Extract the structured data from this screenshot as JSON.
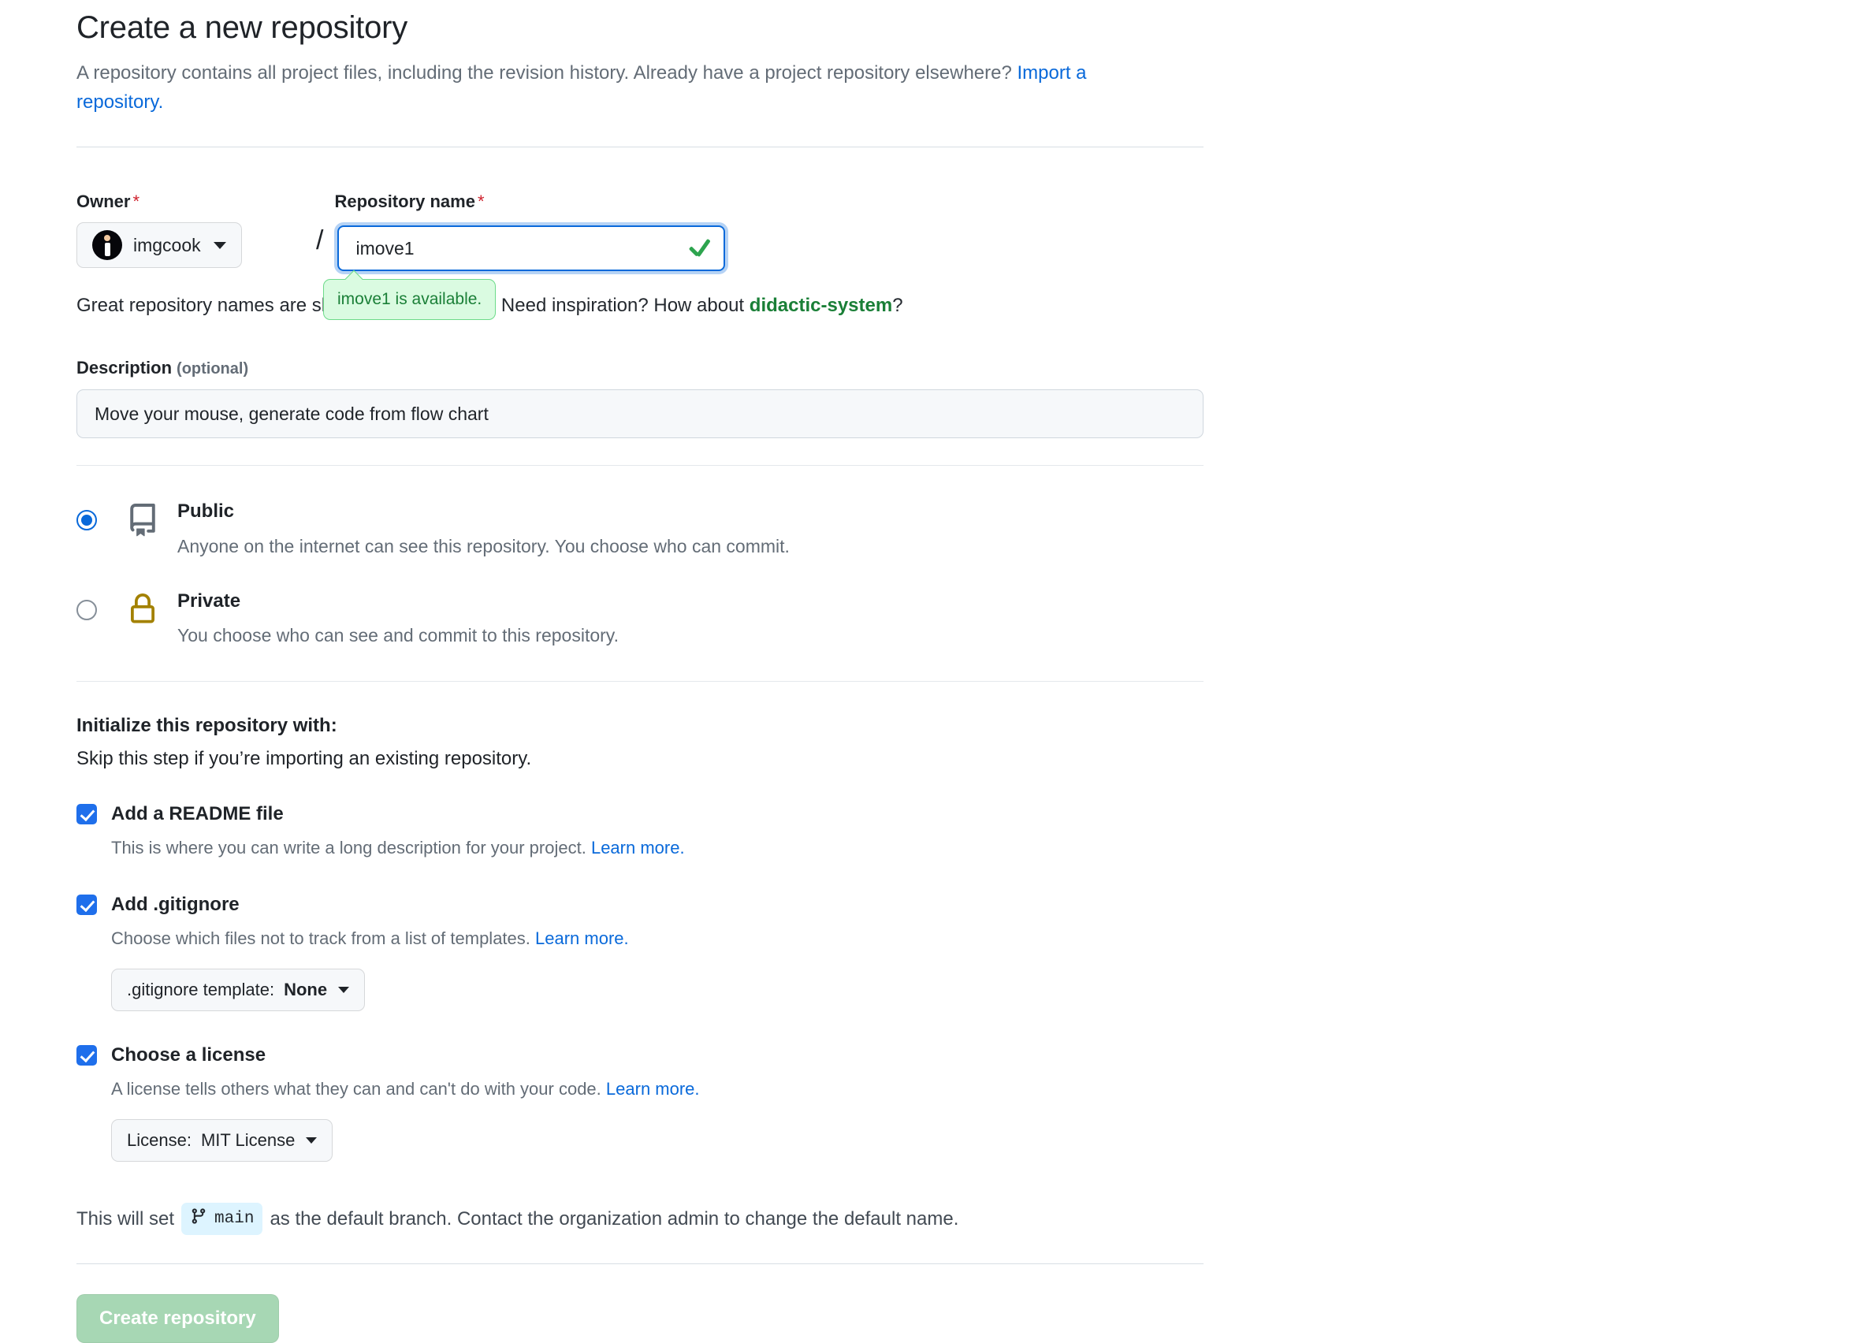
{
  "header": {
    "title": "Create a new repository",
    "subtitle_part1": "A repository contains all project files, including the revision history. Already have a project repository elsewhere? ",
    "import_link": "Import a repository."
  },
  "owner": {
    "label": "Owner",
    "required_mark": "*",
    "name": "imgcook",
    "avatar_icon": "imgcook-avatar-icon",
    "caret_icon": "chevron-down-icon",
    "separator": "/"
  },
  "repository_name": {
    "label": "Repository name",
    "required_mark": "*",
    "value": "imove1",
    "placeholder": "",
    "valid_icon": "check-icon",
    "availability_tooltip": "imove1 is available."
  },
  "hint": {
    "text_before": "Great repository names are short and memorable. Need inspiration? How about ",
    "suggestion": "didactic-system",
    "text_after": "?"
  },
  "description": {
    "label": "Description",
    "optional": "(optional)",
    "value": "Move your mouse, generate code from flow chart",
    "placeholder": ""
  },
  "visibility": {
    "options": [
      {
        "id": "public",
        "title": "Public",
        "description": "Anyone on the internet can see this repository. You choose who can commit.",
        "icon": "repo-book-icon",
        "icon_color": "#636c76",
        "selected": true
      },
      {
        "id": "private",
        "title": "Private",
        "description": "You choose who can see and commit to this repository.",
        "icon": "lock-icon",
        "icon_color": "#a38100",
        "selected": false
      }
    ]
  },
  "initialize": {
    "title": "Initialize this repository with:",
    "subtitle": "Skip this step if you’re importing an existing repository.",
    "readme": {
      "label": "Add a README file",
      "checked": true,
      "description": "This is where you can write a long description for your project. ",
      "learn_more": "Learn more."
    },
    "gitignore": {
      "label": "Add .gitignore",
      "checked": true,
      "description": "Choose which files not to track from a list of templates. ",
      "learn_more": "Learn more.",
      "dropdown_prefix": ".gitignore template: ",
      "dropdown_value": "None",
      "dropdown_caret_icon": "chevron-down-icon"
    },
    "license": {
      "label": "Choose a license",
      "checked": true,
      "description": "A license tells others what they can and can't do with your code. ",
      "learn_more": "Learn more.",
      "dropdown_prefix": "License: ",
      "dropdown_value": "MIT License",
      "dropdown_caret_icon": "chevron-down-icon"
    }
  },
  "default_branch": {
    "text_before": "This will set ",
    "branch_icon": "git-branch-icon",
    "branch_name": "main",
    "text_after": "as the default branch. Contact the organization admin to change the default name."
  },
  "submit": {
    "label": "Create repository",
    "enabled": false
  },
  "colors": {
    "accent_blue": "#0969da",
    "success_green": "#1a7f37",
    "danger_red": "#cf222e",
    "muted_text": "#636c76",
    "lock_gold": "#a38100",
    "button_green_disabled": "#a7d7b4"
  }
}
